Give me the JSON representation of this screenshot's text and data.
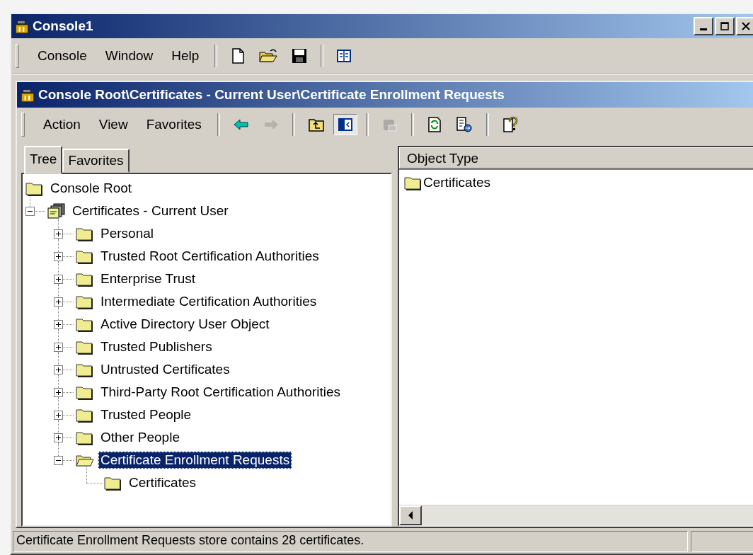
{
  "window": {
    "title": "Console1"
  },
  "menu": [
    "Console",
    "Window",
    "Help"
  ],
  "toolbar": [
    [
      {
        "kind": "new"
      },
      {
        "kind": "open"
      },
      {
        "kind": "save"
      }
    ],
    [
      {
        "kind": "panel"
      }
    ]
  ],
  "child_window": {
    "title": "Console Root\\Certificates - Current User\\Certificate Enrollment Requests",
    "menu": [
      "Action",
      "View",
      "Favorites"
    ],
    "toolbar": [
      [
        {
          "kind": "back",
          "disabled": false,
          "pressed": false
        },
        {
          "kind": "forward",
          "disabled": true,
          "pressed": false
        }
      ],
      [
        {
          "kind": "up",
          "disabled": false,
          "pressed": false
        },
        {
          "kind": "tree",
          "disabled": false,
          "pressed": true
        }
      ],
      [
        {
          "kind": "delete",
          "disabled": true,
          "pressed": false
        }
      ],
      [
        {
          "kind": "refresh",
          "disabled": false,
          "pressed": false
        },
        {
          "kind": "export",
          "disabled": false,
          "pressed": false
        }
      ],
      [
        {
          "kind": "help",
          "disabled": false,
          "pressed": false
        }
      ]
    ]
  },
  "tabs": [
    {
      "label": "Tree",
      "selected": true
    },
    {
      "label": "Favorites",
      "selected": false
    }
  ],
  "tree": [
    {
      "label": "Console Root",
      "kind": "folder",
      "selected": false,
      "children": [
        {
          "label": "Certificates - Current User",
          "kind": "snapin",
          "expanded": true,
          "selected": false,
          "children": [
            {
              "label": "Personal",
              "kind": "folder",
              "expanded": false,
              "selected": false
            },
            {
              "label": "Trusted Root Certification Authorities",
              "kind": "folder",
              "expanded": false,
              "selected": false
            },
            {
              "label": "Enterprise Trust",
              "kind": "folder",
              "expanded": false,
              "selected": false
            },
            {
              "label": "Intermediate Certification Authorities",
              "kind": "folder",
              "expanded": false,
              "selected": false
            },
            {
              "label": "Active Directory User Object",
              "kind": "folder",
              "expanded": false,
              "selected": false
            },
            {
              "label": "Trusted Publishers",
              "kind": "folder",
              "expanded": false,
              "selected": false
            },
            {
              "label": "Untrusted Certificates",
              "kind": "folder",
              "expanded": false,
              "selected": false
            },
            {
              "label": "Third-Party Root Certification Authorities",
              "kind": "folder",
              "expanded": false,
              "selected": false
            },
            {
              "label": "Trusted People",
              "kind": "folder",
              "expanded": false,
              "selected": false
            },
            {
              "label": "Other People",
              "kind": "folder",
              "expanded": false,
              "selected": false
            },
            {
              "label": "Certificate Enrollment Requests",
              "kind": "folder",
              "expanded": true,
              "selected": true,
              "children": [
                {
                  "label": "Certificates",
                  "kind": "folder",
                  "selected": false
                }
              ]
            }
          ]
        }
      ]
    }
  ],
  "list": {
    "columns": [
      "Object Type"
    ],
    "rows": [
      {
        "name": "Certificates"
      }
    ]
  },
  "status_bar": {
    "text": "Certificate Enrollment Requests store contains 28 certificates."
  }
}
